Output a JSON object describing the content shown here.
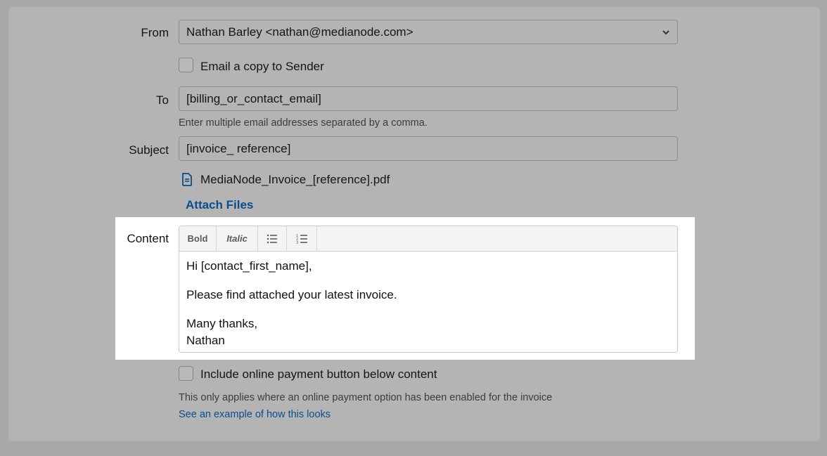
{
  "form": {
    "from_label": "From",
    "from_value": "Nathan Barley <nathan@medianode.com>",
    "copy_to_sender_label": "Email a copy to Sender",
    "to_label": "To",
    "to_value": "[billing_or_contact_email]",
    "to_help": "Enter multiple email addresses separated by a comma.",
    "subject_label": "Subject",
    "subject_value": "[invoice_ reference]",
    "attachment_name": "MediaNode_Invoice_[reference].pdf",
    "attach_files_label": "Attach Files",
    "content_label": "Content",
    "payment_button_label": "Include online payment button below content",
    "payment_help": "This only applies where an online payment option has been enabled for the invoice",
    "example_link": "See an example of how this looks"
  },
  "editor": {
    "toolbar": {
      "bold_label": "Bold",
      "italic_label": "Italic",
      "bullet_list_icon": "bullet-list-icon",
      "numbered_list_icon": "numbered-list-icon"
    },
    "body": {
      "greeting": "Hi [contact_first_name],",
      "line1": "Please find attached your latest invoice.",
      "signoff": "Many thanks,",
      "name": "Nathan"
    }
  },
  "colors": {
    "overlay_background": "#a9a9a9",
    "link_blue": "#0b4c8c",
    "highlight": "#ffffff"
  }
}
